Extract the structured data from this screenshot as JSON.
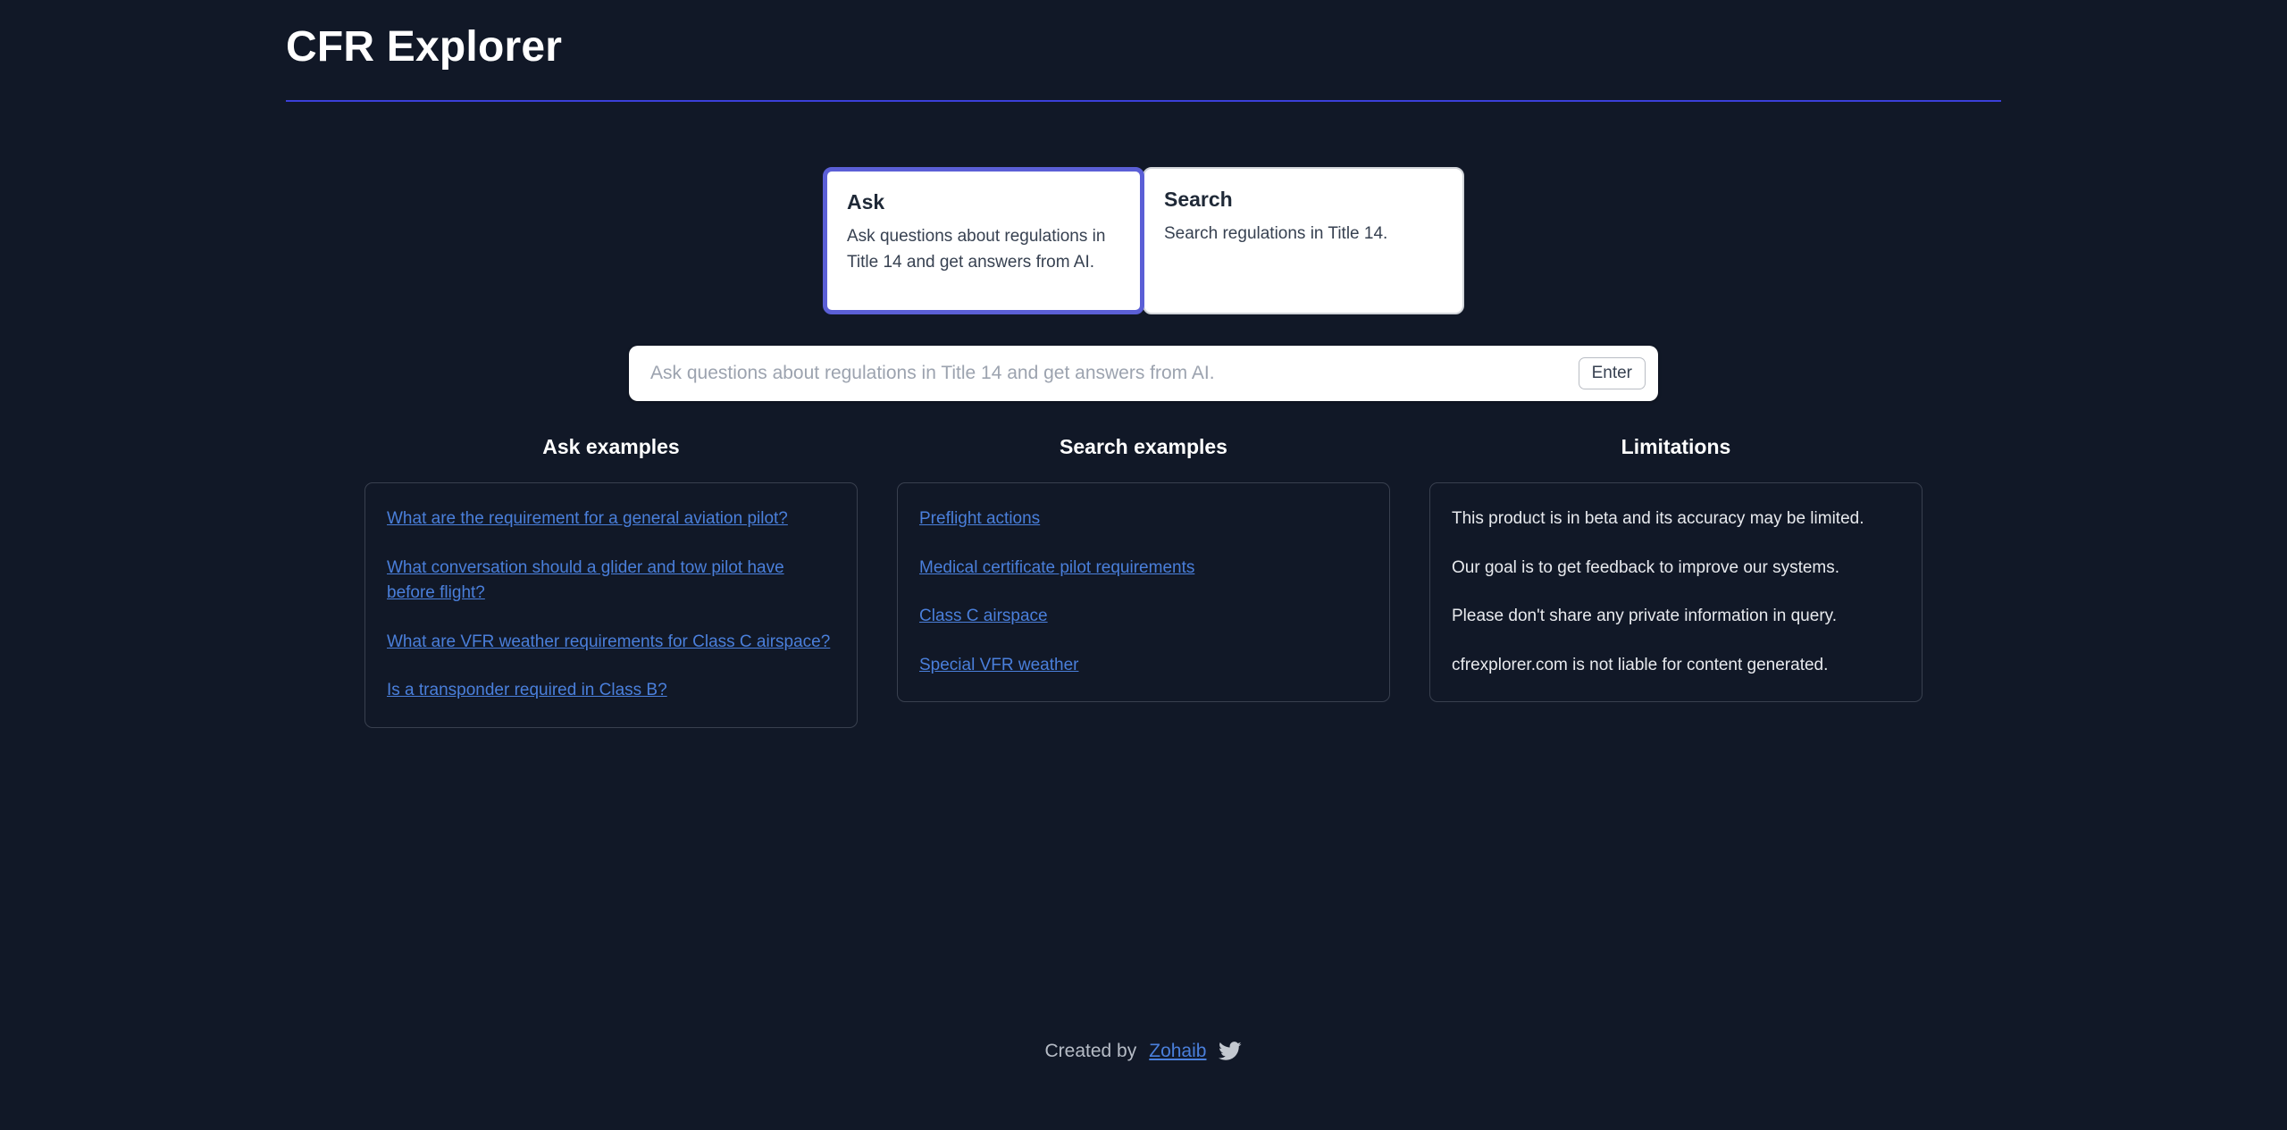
{
  "header": {
    "title": "CFR Explorer",
    "rule_color": "#3b3fd8"
  },
  "tabs": [
    {
      "id": "ask",
      "label": "Ask",
      "description": "Ask questions about regulations in Title 14 and get answers from AI.",
      "selected": true,
      "border_color": "#5b5fd6"
    },
    {
      "id": "search",
      "label": "Search",
      "description": "Search regulations in Title 14.",
      "selected": false,
      "border_color": "#d2d5da"
    }
  ],
  "search": {
    "value": "",
    "placeholder": "Ask questions about regulations in Title 14 and get answers from AI.",
    "enter_label": "Enter"
  },
  "columns": {
    "ask_examples": {
      "heading": "Ask examples",
      "items": [
        "What are the requirement for a general aviation pilot?",
        "What conversation should a glider and tow pilot have before flight?",
        "What are VFR weather requirements for Class C airspace?",
        "Is a transponder required in Class B?"
      ]
    },
    "search_examples": {
      "heading": "Search examples",
      "items": [
        "Preflight actions",
        "Medical certificate pilot requirements",
        "Class C airspace",
        "Special VFR weather"
      ]
    },
    "limitations": {
      "heading": "Limitations",
      "items": [
        "This product is in beta and its accuracy may be limited.",
        "Our goal is to get feedback to improve our systems.",
        "Please don't share any private information in query.",
        "cfrexplorer.com is not liable for content generated."
      ]
    }
  },
  "footer": {
    "prefix": "Created by",
    "author": "Zohaib",
    "icon": "twitter-icon"
  },
  "colors": {
    "background": "#111827",
    "link": "#4a7fdb",
    "accent": "#5b5fd6",
    "panel_border": "#39404f",
    "placeholder": "#9ca3af"
  }
}
